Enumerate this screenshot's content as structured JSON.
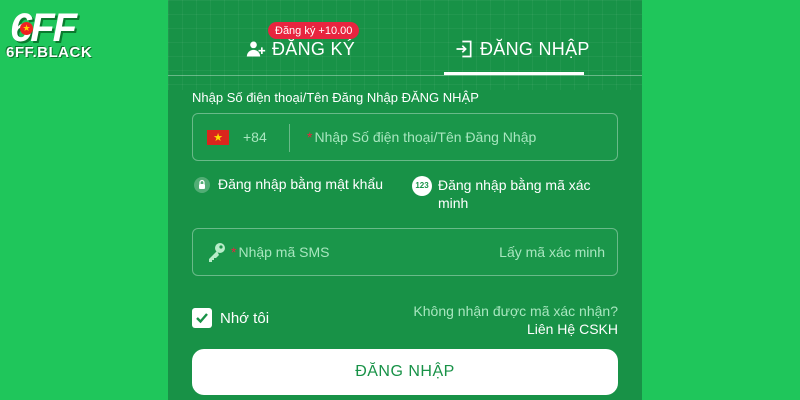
{
  "brand": {
    "logo_main": "6FF",
    "logo_sub": "6FF.BLACK"
  },
  "tabs": {
    "register": {
      "label": "ĐĂNG KÝ",
      "badge": "Đăng ký +10.00"
    },
    "login": {
      "label": "ĐĂNG NHẬP",
      "active": true
    }
  },
  "form": {
    "phone_label": "Nhập Số điện thoại/Tên Đăng Nhập ĐĂNG NHẬP",
    "country_code": "+84",
    "phone_placeholder": "Nhập Số điện thoại/Tên Đăng Nhập",
    "method_password": "Đăng nhập bằng mật khẩu",
    "method_code": "Đăng nhập bằng mã xác minh",
    "method_code_icon": "123",
    "sms_placeholder": "Nhập mã SMS",
    "get_code": "Lấy mã xác minh",
    "remember_me": "Nhớ tôi",
    "remember_checked": true,
    "no_code_question": "Không nhận được mã xác nhận?",
    "support_link": "Liên Hệ CSKH",
    "submit_label": "ĐĂNG NHẬP"
  },
  "colors": {
    "page_bg": "#1ec55a",
    "panel_bg": "#189247",
    "badge_bg": "#e8243f",
    "muted_text": "#a8e6bf"
  },
  "icons": [
    "add-user-icon",
    "login-door-icon",
    "vietnam-flag-icon",
    "lock-icon",
    "numbers-123-icon",
    "key-icon",
    "checkmark-icon"
  ]
}
